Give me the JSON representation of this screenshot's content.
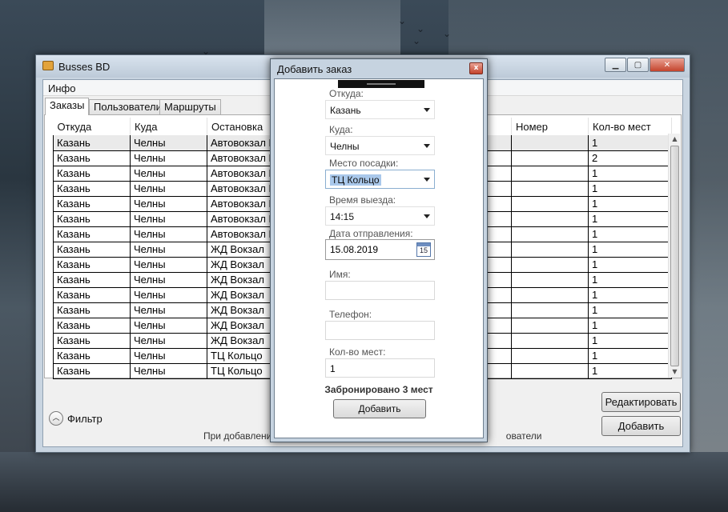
{
  "main_window": {
    "title": "Busses BD",
    "menu": [
      "Инфо"
    ],
    "tabs": [
      "Заказы",
      "Пользователи",
      "Маршруты"
    ],
    "columns": [
      "Откуда",
      "Куда",
      "Остановка",
      "Номер",
      "Кол-во мест"
    ],
    "rows": [
      {
        "from": "Казань",
        "to": "Челны",
        "stop": "Автовокзал Во",
        "seats": "1"
      },
      {
        "from": "Казань",
        "to": "Челны",
        "stop": "Автовокзал Во",
        "seats": "2"
      },
      {
        "from": "Казань",
        "to": "Челны",
        "stop": "Автовокзал Во",
        "seats": "1"
      },
      {
        "from": "Казань",
        "to": "Челны",
        "stop": "Автовокзал Во",
        "seats": "1"
      },
      {
        "from": "Казань",
        "to": "Челны",
        "stop": "Автовокзал Во",
        "seats": "1"
      },
      {
        "from": "Казань",
        "to": "Челны",
        "stop": "Автовокзал Во",
        "seats": "1"
      },
      {
        "from": "Казань",
        "to": "Челны",
        "stop": "Автовокзал Во",
        "seats": "1"
      },
      {
        "from": "Казань",
        "to": "Челны",
        "stop": "ЖД Вокзал",
        "seats": "1"
      },
      {
        "from": "Казань",
        "to": "Челны",
        "stop": "ЖД Вокзал",
        "seats": "1"
      },
      {
        "from": "Казань",
        "to": "Челны",
        "stop": "ЖД Вокзал",
        "seats": "1"
      },
      {
        "from": "Казань",
        "to": "Челны",
        "stop": "ЖД Вокзал",
        "seats": "1"
      },
      {
        "from": "Казань",
        "to": "Челны",
        "stop": "ЖД Вокзал",
        "seats": "1"
      },
      {
        "from": "Казань",
        "to": "Челны",
        "stop": "ЖД Вокзал",
        "seats": "1"
      },
      {
        "from": "Казань",
        "to": "Челны",
        "stop": "ЖД Вокзал",
        "seats": "1"
      },
      {
        "from": "Казань",
        "to": "Челны",
        "stop": "ТЦ Кольцо",
        "seats": "1"
      },
      {
        "from": "Казань",
        "to": "Челны",
        "stop": "ТЦ Кольцо",
        "seats": "1"
      }
    ],
    "filter_label": "Фильтр",
    "hint_left": "При добавлении",
    "hint_right": "ователи",
    "edit_button": "Редактировать",
    "add_button": "Добавить"
  },
  "dialog": {
    "title": "Добавить заказ",
    "close_glyph": "x",
    "from_label": "Откуда:",
    "from_value": "Казань",
    "to_label": "Куда:",
    "to_value": "Челны",
    "stop_label": "Место посадки:",
    "stop_value": "ТЦ Кольцо",
    "time_label": "Время выезда:",
    "time_value": "14:15",
    "date_label": "Дата отправления:",
    "date_value": "15.08.2019",
    "calendar_day": "15",
    "name_label": "Имя:",
    "name_value": "",
    "phone_label": "Телефон:",
    "phone_value": "",
    "seats_label": "Кол-во мест:",
    "seats_value": "1",
    "booked_text": "Забронировано 3 мест",
    "add_button": "Добавить"
  },
  "colors": {
    "window_frame": "#c9d5e1",
    "selection": "#a9c8eb",
    "close_red": "#c4432c"
  }
}
